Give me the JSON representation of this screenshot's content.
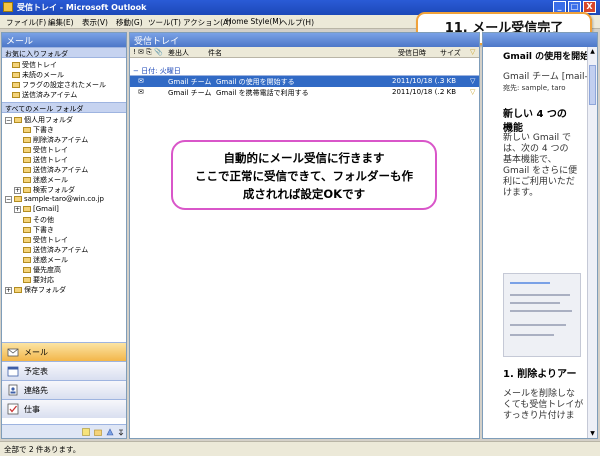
{
  "window": {
    "title": "受信トレイ - Microsoft Outlook",
    "controls": [
      "_",
      "□",
      "X"
    ]
  },
  "menu": {
    "items": [
      "ファイル(F)",
      "編集(E)",
      "表示(V)",
      "移動(G)",
      "ツール(T)",
      "アクション(A)",
      "Home Style(M)",
      "ヘルプ(H)"
    ],
    "help_dropdown": "▾"
  },
  "callout": {
    "text": "11. メール受信完了"
  },
  "left_pane": {
    "header": "メール",
    "favorites_label": "お気に入りフォルダ",
    "favorites": [
      "受信トレイ",
      "未読のメール",
      "フラグの設定されたメール",
      "送信済みアイテム"
    ],
    "all_folders_label": "すべてのメール フォルダ",
    "tree": [
      {
        "label": "個人用フォルダ",
        "level": 0,
        "expander": "−"
      },
      {
        "label": "下書き",
        "level": 1
      },
      {
        "label": "削除済みアイテム",
        "level": 1
      },
      {
        "label": "受信トレイ",
        "level": 1
      },
      {
        "label": "送信トレイ",
        "level": 1
      },
      {
        "label": "送信済みアイテム",
        "level": 1
      },
      {
        "label": "迷惑メール",
        "level": 1
      },
      {
        "label": "検索フォルダ",
        "level": 1,
        "expander": "+"
      },
      {
        "label": "sample-taro@win.co.jp",
        "level": 0,
        "expander": "−"
      },
      {
        "label": "[Gmail]",
        "level": 1,
        "expander": "+"
      },
      {
        "label": "その他",
        "level": 1
      },
      {
        "label": "下書き",
        "level": 1
      },
      {
        "label": "受信トレイ",
        "level": 1
      },
      {
        "label": "送信済みアイテム",
        "level": 1
      },
      {
        "label": "迷惑メール",
        "level": 1
      },
      {
        "label": "優先度高",
        "level": 1
      },
      {
        "label": "要対応",
        "level": 1
      },
      {
        "label": "保存フォルダ",
        "level": 0,
        "expander": "+"
      }
    ],
    "nav_buttons": [
      "メール",
      "予定表",
      "連絡先",
      "仕事"
    ]
  },
  "middle_pane": {
    "header": "受信トレイ",
    "columns": {
      "icons": "!  ✉  ⎘  📎",
      "sender": "差出人",
      "subject": "件名",
      "received": "受信日時",
      "size": "サイズ"
    },
    "group_label": "日付: 火曜日",
    "emails": [
      {
        "sender": "Gmail チーム",
        "subject": "Gmail の使用を開始する",
        "date": "2011/10/18 (...",
        "size": "3 KB",
        "selected": true
      },
      {
        "sender": "Gmail チーム",
        "subject": "Gmail を携帯電話で利用する",
        "date": "2011/10/18 (...",
        "size": "2 KB",
        "selected": false
      }
    ]
  },
  "balloon": {
    "lines": [
      "自動的にメール受信に行きます",
      "ここで正常に受信できて、フォルダーも作",
      "成されれば設定OKです"
    ]
  },
  "reading_pane": {
    "header_partial": "Gmail の使用を開始する",
    "from_line": "Gmail チーム [mail-nor",
    "recipient_label": "宛先:",
    "recipient": "sample, taro",
    "heading": [
      "新しい 4 つの",
      "機能"
    ],
    "body": [
      "新しい Gmail で",
      "は、次の 4 つの",
      "基本機能で、",
      "Gmail をさらに便",
      "利にご利用いただ",
      "けます。"
    ],
    "section": "1. 削除よりアー",
    "section_body": [
      "メールを削除しな",
      "くても受信トレイが",
      "すっきり片付けま"
    ]
  },
  "status_bar": {
    "text": "全部で 2 件あります。"
  },
  "colors": {
    "title_bar": "#1c48b8",
    "pane_header": "#4d77c8",
    "selected_row": "#316ac5",
    "callout_border": "#f0a23a",
    "balloon_border": "#d956c9"
  }
}
